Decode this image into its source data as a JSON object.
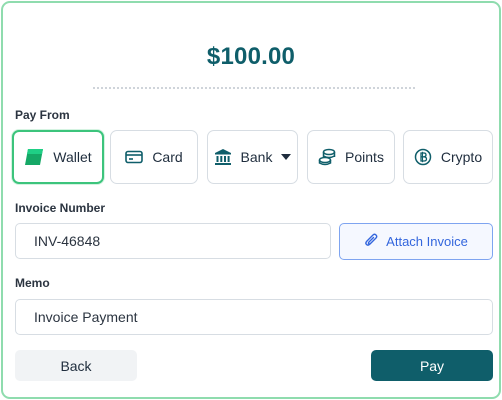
{
  "payment": {
    "amount": "$100.00"
  },
  "pay_from": {
    "label": "Pay From",
    "methods": [
      {
        "label": "Wallet",
        "icon": "wallet-icon",
        "selected": true
      },
      {
        "label": "Card",
        "icon": "credit-card-icon",
        "selected": false
      },
      {
        "label": "Bank",
        "icon": "bank-icon",
        "selected": false,
        "has_dropdown": true
      },
      {
        "label": "Points",
        "icon": "coins-stack-icon",
        "selected": false
      },
      {
        "label": "Crypto",
        "icon": "bitcoin-icon",
        "selected": false
      }
    ]
  },
  "invoice": {
    "label": "Invoice Number",
    "value": "INV-46848",
    "attach_label": "Attach Invoice"
  },
  "memo": {
    "label": "Memo",
    "value": "Invoice Payment"
  },
  "actions": {
    "back_label": "Back",
    "pay_label": "Pay"
  },
  "colors": {
    "primary": "#0f5e6a",
    "selected_border": "#3cc47c",
    "link_blue": "#3366dd",
    "card_border": "#8fdcae"
  }
}
